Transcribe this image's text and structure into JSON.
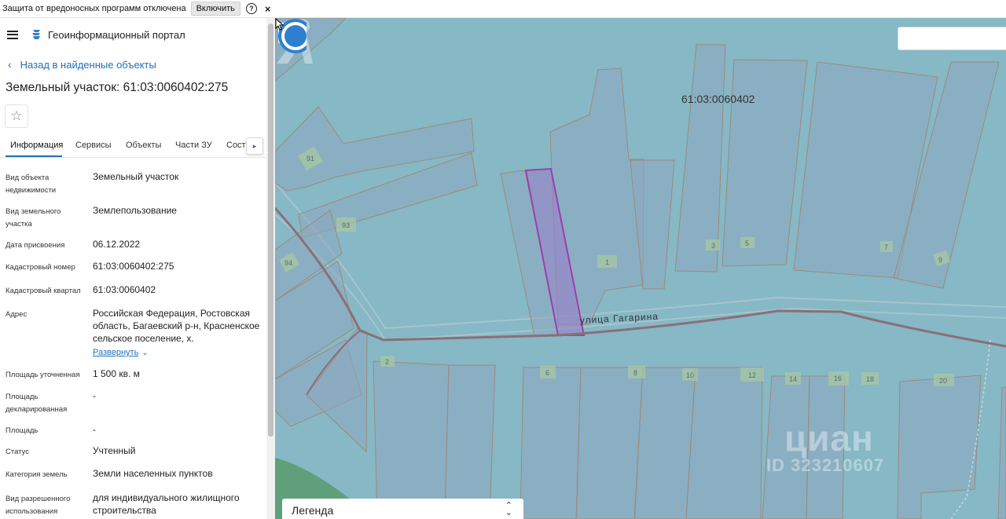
{
  "notification": {
    "message": "Защита от вредоносных программ отключена",
    "enable_label": "Включить",
    "help_icon": "?",
    "close_icon": "×"
  },
  "header": {
    "portal_title": "Геоинформационный портал"
  },
  "nav": {
    "back_label": "Назад в найденные объекты",
    "back_icon": "‹"
  },
  "object": {
    "title": "Земельный участок: 61:03:0060402:275",
    "favorite_icon": "☆"
  },
  "tabs": {
    "items": [
      "Информация",
      "Сервисы",
      "Объекты",
      "Части ЗУ",
      "Соста"
    ],
    "scroll_icon": "▸"
  },
  "properties": {
    "object_kind": {
      "label": "Вид объекта недвижимости",
      "value": "Земельный участок"
    },
    "land_kind": {
      "label": "Вид земельного участка",
      "value": "Землепользование"
    },
    "assign_date": {
      "label": "Дата присвоения",
      "value": "06.12.2022"
    },
    "cad_number": {
      "label": "Кадастровый номер",
      "value": "61:03:0060402:275"
    },
    "cad_quarter": {
      "label": "Кадастровый квартал",
      "value": "61:03:0060402"
    },
    "address": {
      "label": "Адрес",
      "value": "Российская Федерация, Ростовская область, Багаевский р-н, Красненское сельское поселение, х.",
      "expand_label": "Развернуть",
      "expand_icon": "⌄"
    },
    "area_precise": {
      "label": "Площадь уточненная",
      "value": "1 500 кв. м"
    },
    "area_declared": {
      "label": "Площадь декларированная",
      "value": "-"
    },
    "area": {
      "label": "Площадь",
      "value": "-"
    },
    "status": {
      "label": "Статус",
      "value": "Учтенный"
    },
    "land_category": {
      "label": "Категория земель",
      "value": "Земли населенных пунктов"
    },
    "permitted_use": {
      "label": "Вид разрешенного использования",
      "value": "для индивидуального жилищного строительства"
    }
  },
  "map": {
    "collapse_icon": "«",
    "quarter_label": "61:03:0060402",
    "street_label": "улица Гагарина",
    "parcel_numbers": [
      "91",
      "93",
      "94",
      "1",
      "3",
      "5",
      "7",
      "9",
      "2",
      "6",
      "8",
      "10",
      "12",
      "14",
      "16",
      "18",
      "20"
    ],
    "watermark": "циан",
    "watermark_id": "ID 323210607",
    "legend_label": "Легенда",
    "legend_icon": "chevron-up-down-icon"
  },
  "colors": {
    "accent": "#1e6fbf",
    "map_water": "#86b8c6",
    "parcel_fill": "#8fa7c0",
    "parcel_stroke": "#9a8a7c",
    "selected_parcel": "#9b3fb0",
    "road": "#8a6f78",
    "green_area": "#5fa07a"
  }
}
